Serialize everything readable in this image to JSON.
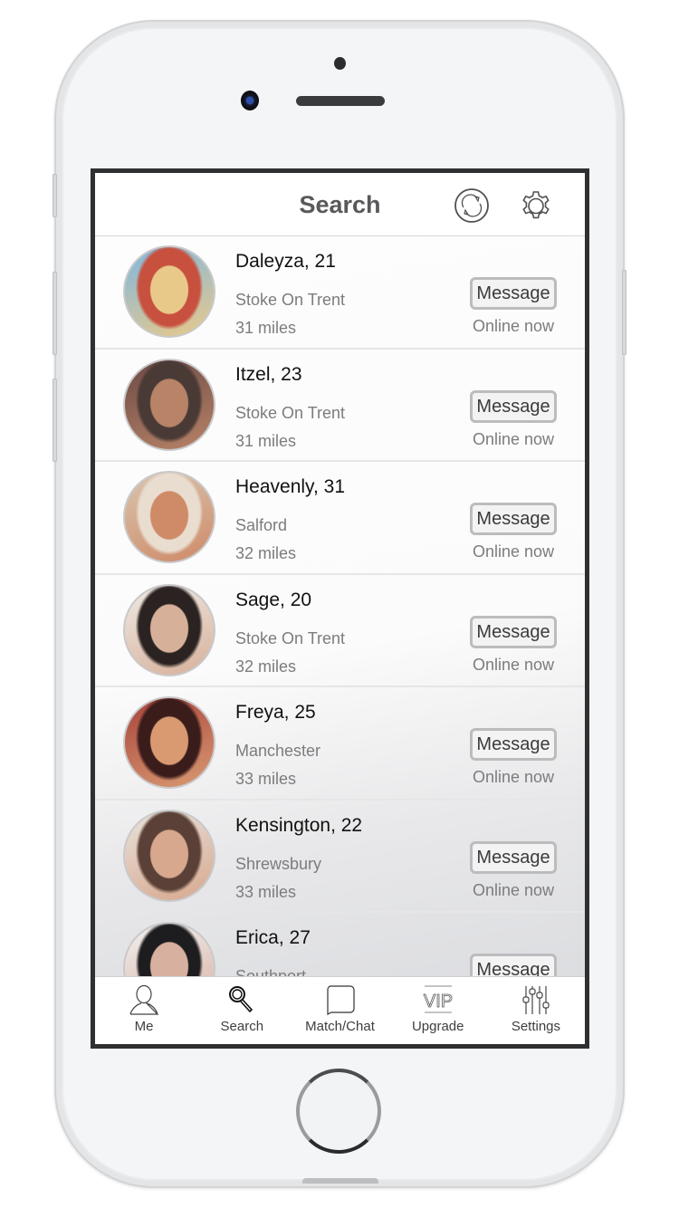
{
  "header": {
    "title": "Search",
    "refresh_icon": "refresh-icon",
    "settings_icon": "gear-icon"
  },
  "profiles": [
    {
      "name_age": "Daleyza, 21",
      "city": "Stoke On Trent",
      "distance": "31 miles",
      "button": "Message",
      "status": "Online now",
      "avatar_colors": [
        "#7fb7e0",
        "#e9c98a",
        "#c8503e"
      ]
    },
    {
      "name_age": "Itzel, 23",
      "city": "Stoke On Trent",
      "distance": "31 miles",
      "button": "Message",
      "status": "Online now",
      "avatar_colors": [
        "#6c4a45",
        "#b88367",
        "#4a3a36"
      ]
    },
    {
      "name_age": "Heavenly, 31",
      "city": "Salford",
      "distance": "32 miles",
      "button": "Message",
      "status": "Online now",
      "avatar_colors": [
        "#d8c6b0",
        "#cf8a68",
        "#e9ddd0"
      ]
    },
    {
      "name_age": "Sage, 20",
      "city": "Stoke On Trent",
      "distance": "32 miles",
      "button": "Message",
      "status": "Online now",
      "avatar_colors": [
        "#efeae4",
        "#d7b09a",
        "#2a2322"
      ]
    },
    {
      "name_age": "Freya, 25",
      "city": "Manchester",
      "distance": "33 miles",
      "button": "Message",
      "status": "Online now",
      "avatar_colors": [
        "#a8433b",
        "#d99a72",
        "#3a1c1b"
      ]
    },
    {
      "name_age": "Kensington, 22",
      "city": "Shrewsbury",
      "distance": "33 miles",
      "button": "Message",
      "status": "Online now",
      "avatar_colors": [
        "#e8e2dc",
        "#d7a88e",
        "#5a4036"
      ]
    },
    {
      "name_age": "Erica, 27",
      "city": "Southport",
      "distance": "",
      "button": "Message",
      "status": "",
      "avatar_colors": [
        "#f1f1f1",
        "#d8b0a0",
        "#1d1d1f"
      ]
    }
  ],
  "tabs": [
    {
      "label": "Me",
      "icon": "person-icon"
    },
    {
      "label": "Search",
      "icon": "magnifier-icon"
    },
    {
      "label": "Match/Chat",
      "icon": "chat-bubble-icon"
    },
    {
      "label": "Upgrade",
      "icon": "vip-icon",
      "icon_text": "VIP"
    },
    {
      "label": "Settings",
      "icon": "sliders-icon"
    }
  ],
  "colors": {
    "title_text": "#58595b",
    "secondary_text": "#7c7c7e",
    "button_border": "#bcbcbe",
    "screen_bezel": "#2f3032"
  }
}
